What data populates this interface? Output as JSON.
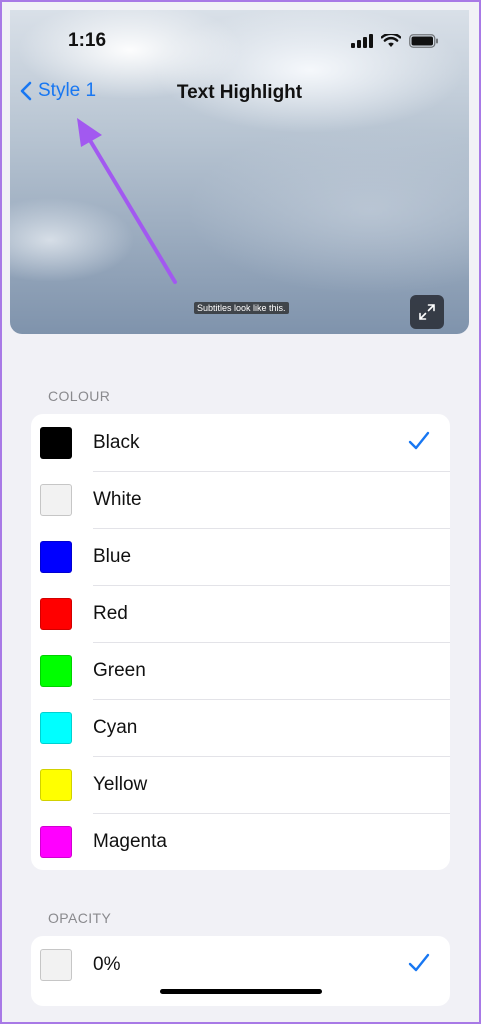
{
  "status_bar": {
    "time": "1:16"
  },
  "nav": {
    "back_label": "Style 1",
    "title": "Text Highlight"
  },
  "preview": {
    "subtitle_sample": "Subtitles look like this."
  },
  "colour_section": {
    "header": "COLOUR",
    "items": [
      {
        "label": "Black",
        "color": "#000000",
        "selected": true
      },
      {
        "label": "White",
        "color": "#f2f2f2",
        "selected": false
      },
      {
        "label": "Blue",
        "color": "#0000ff",
        "selected": false
      },
      {
        "label": "Red",
        "color": "#ff0000",
        "selected": false
      },
      {
        "label": "Green",
        "color": "#00ff00",
        "selected": false
      },
      {
        "label": "Cyan",
        "color": "#00ffff",
        "selected": false
      },
      {
        "label": "Yellow",
        "color": "#ffff00",
        "selected": false
      },
      {
        "label": "Magenta",
        "color": "#ff00ff",
        "selected": false
      }
    ]
  },
  "opacity_section": {
    "header": "OPACITY",
    "items": [
      {
        "label": "0%",
        "color": "#f2f2f2",
        "selected": true
      }
    ]
  },
  "colors": {
    "accent": "#1877f2",
    "annotation": "#a259f0"
  }
}
